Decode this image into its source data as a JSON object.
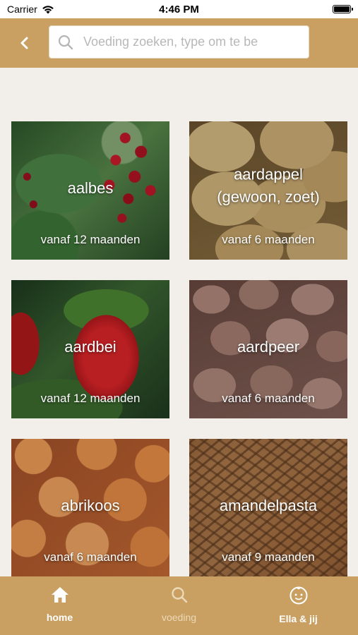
{
  "status_bar": {
    "carrier": "Carrier",
    "time": "4:46 PM",
    "icons": [
      "wifi-icon",
      "battery-icon"
    ]
  },
  "header": {
    "back_icon": "chevron-left-icon",
    "search": {
      "icon": "search-icon",
      "placeholder": "Voeding zoeken, type om te be",
      "value": ""
    },
    "background_color": "#c9a061"
  },
  "foods": [
    {
      "name": "aalbes",
      "age": "vanaf 12 maanden"
    },
    {
      "name": "aardappel (gewoon, zoet)",
      "age": "vanaf 6 maanden"
    },
    {
      "name": "aardbei",
      "age": "vanaf 12 maanden"
    },
    {
      "name": "aardpeer",
      "age": "vanaf 6 maanden"
    },
    {
      "name": "abrikoos",
      "age": "vanaf 6 maanden"
    },
    {
      "name": "amandelpasta",
      "age": "vanaf 9 maanden"
    }
  ],
  "bottom_nav": {
    "items": [
      {
        "label": "home",
        "icon": "home-icon",
        "state": "active"
      },
      {
        "label": "voeding",
        "icon": "search-icon",
        "state": "inactive"
      },
      {
        "label": "Ella & jij",
        "icon": "baby-face-icon",
        "state": "normal"
      }
    ]
  },
  "colors": {
    "accent": "#c9a061",
    "background": "#f2eeea"
  }
}
